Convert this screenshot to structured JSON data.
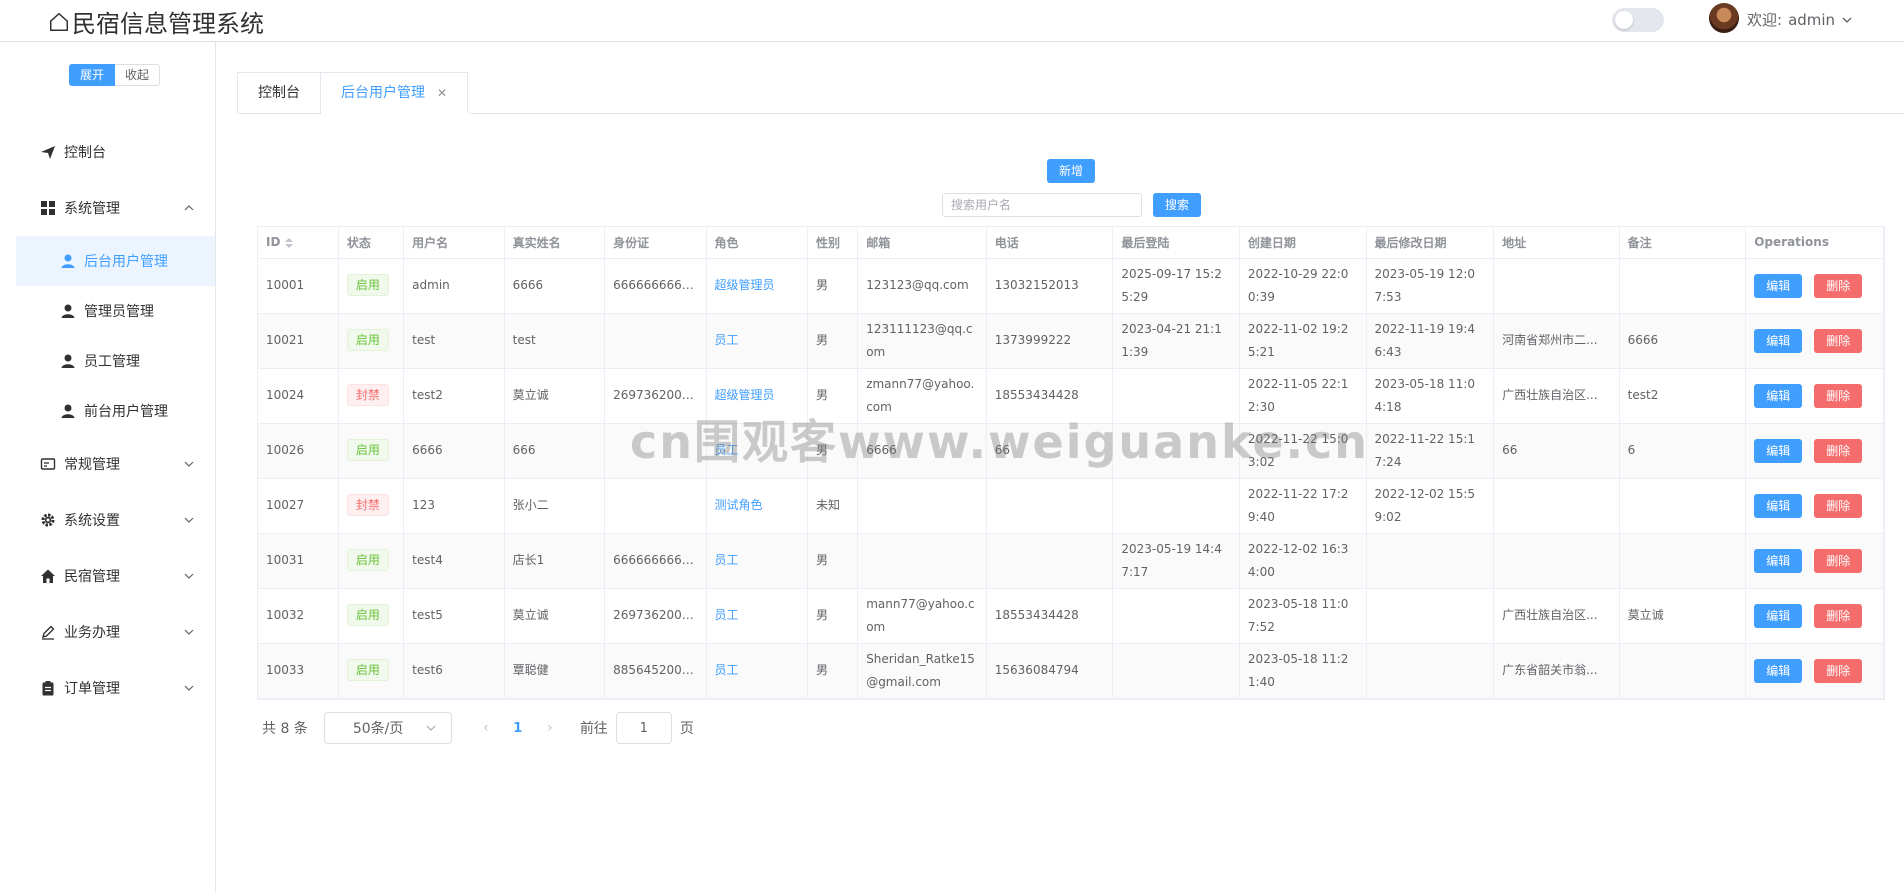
{
  "header": {
    "title": "民宿信息管理系统",
    "welcome": "欢迎:",
    "username": "admin"
  },
  "sidebar": {
    "expand_label": "展开",
    "collapse_label": "收起",
    "items": [
      {
        "label": "控制台",
        "icon": "send-icon"
      },
      {
        "label": "系统管理",
        "icon": "grid-icon"
      },
      {
        "label": "后台用户管理",
        "icon": "user-icon"
      },
      {
        "label": "管理员管理",
        "icon": "user-icon"
      },
      {
        "label": "员工管理",
        "icon": "user-icon"
      },
      {
        "label": "前台用户管理",
        "icon": "user-icon"
      },
      {
        "label": "常规管理",
        "icon": "card-icon"
      },
      {
        "label": "系统设置",
        "icon": "gear-icon"
      },
      {
        "label": "民宿管理",
        "icon": "house-icon"
      },
      {
        "label": "业务办理",
        "icon": "pen-icon"
      },
      {
        "label": "订单管理",
        "icon": "clipboard-icon"
      }
    ]
  },
  "tabs": [
    {
      "label": "控制台"
    },
    {
      "label": "后台用户管理"
    }
  ],
  "toolbar": {
    "add_label": "新增",
    "search_placeholder": "搜索用户名",
    "search_label": "搜索"
  },
  "table": {
    "headers": [
      "ID",
      "状态",
      "用户名",
      "真实姓名",
      "身份证",
      "角色",
      "性别",
      "邮箱",
      "电话",
      "最后登陆",
      "创建日期",
      "最后修改日期",
      "地址",
      "备注",
      "Operations"
    ],
    "edit_label": "编辑",
    "delete_label": "删除",
    "rows": [
      {
        "id": "10001",
        "status": "启用",
        "username": "admin",
        "realname": "6666",
        "idcard": "6666666666...",
        "role": "超级管理员",
        "gender": "男",
        "email": "123123@qq.com",
        "phone": "13032152013",
        "last_login": "2025-09-17 15:25:29",
        "created": "2022-10-29 22:00:39",
        "modified": "2023-05-19 12:07:53",
        "address": "",
        "remark": ""
      },
      {
        "id": "10021",
        "status": "启用",
        "username": "test",
        "realname": "test",
        "idcard": "",
        "role": "员工",
        "gender": "男",
        "email": "123111123@qq.com",
        "phone": "1373999222",
        "last_login": "2023-04-21 21:11:39",
        "created": "2022-11-02 19:25:21",
        "modified": "2022-11-19 19:46:43",
        "address": "河南省郑州市二...",
        "remark": "6666"
      },
      {
        "id": "10024",
        "status": "封禁",
        "username": "test2",
        "realname": "莫立诚",
        "idcard": "2697362001...",
        "role": "超级管理员",
        "gender": "男",
        "email": "zmann77@yahoo.com",
        "phone": "18553434428",
        "last_login": "",
        "created": "2022-11-05 22:12:30",
        "modified": "2023-05-18 11:04:18",
        "address": "广西壮族自治区...",
        "remark": "test2"
      },
      {
        "id": "10026",
        "status": "启用",
        "username": "6666",
        "realname": "666",
        "idcard": "",
        "role": "员工",
        "gender": "男",
        "email": "6666",
        "phone": "66",
        "last_login": "",
        "created": "2022-11-22 15:03:02",
        "modified": "2022-11-22 15:17:24",
        "address": "66",
        "remark": "6"
      },
      {
        "id": "10027",
        "status": "封禁",
        "username": "123",
        "realname": "张小二",
        "idcard": "",
        "role": "测试角色",
        "gender": "未知",
        "email": "",
        "phone": "",
        "last_login": "",
        "created": "2022-11-22 17:29:40",
        "modified": "2022-12-02 15:59:02",
        "address": "",
        "remark": ""
      },
      {
        "id": "10031",
        "status": "启用",
        "username": "test4",
        "realname": "店长1",
        "idcard": "6666666666...",
        "role": "员工",
        "gender": "男",
        "email": "",
        "phone": "",
        "last_login": "2023-05-19 14:47:17",
        "created": "2022-12-02 16:34:00",
        "modified": "",
        "address": "",
        "remark": ""
      },
      {
        "id": "10032",
        "status": "启用",
        "username": "test5",
        "realname": "莫立诚",
        "idcard": "2697362001...",
        "role": "员工",
        "gender": "男",
        "email": "mann77@yahoo.com",
        "phone": "18553434428",
        "last_login": "",
        "created": "2023-05-18 11:07:52",
        "modified": "",
        "address": "广西壮族自治区...",
        "remark": "莫立诚"
      },
      {
        "id": "10033",
        "status": "启用",
        "username": "test6",
        "realname": "覃聪健",
        "idcard": "8856452009...",
        "role": "员工",
        "gender": "男",
        "email": "Sheridan_Ratke15@gmail.com",
        "phone": "15636084794",
        "last_login": "",
        "created": "2023-05-18 11:21:40",
        "modified": "",
        "address": "广东省韶关市翁...",
        "remark": ""
      }
    ]
  },
  "pagination": {
    "total": "共 8 条",
    "page_size": "50条/页",
    "current_page": "1",
    "goto_label": "前往",
    "goto_value": "1",
    "page_suffix": "页"
  },
  "watermark": "cn围观客www.weiguanke.cn",
  "colors": {
    "primary": "#409eff",
    "danger": "#f56c6c",
    "success": "#67c23a"
  }
}
